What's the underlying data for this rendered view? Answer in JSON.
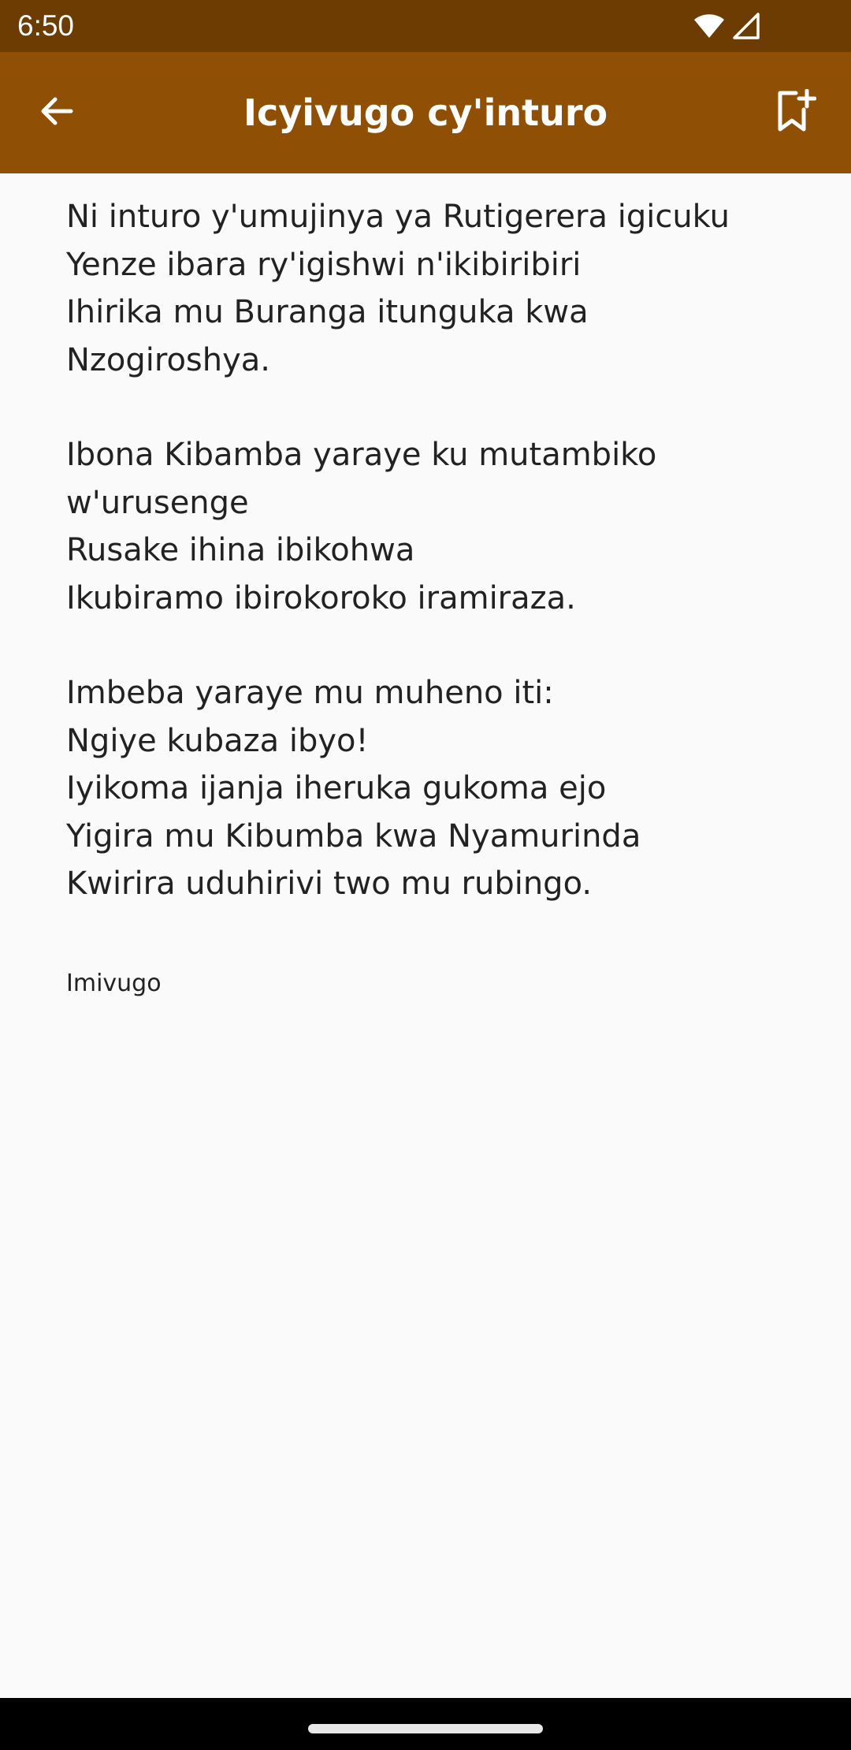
{
  "status_bar": {
    "time": "6:50",
    "icons": [
      "wifi-icon",
      "cellular-signal-icon"
    ]
  },
  "app_bar": {
    "title": "Icyivugo cy'inturo",
    "back_icon": "arrow-back-icon",
    "bookmark_icon": "bookmark-add-icon"
  },
  "poem": {
    "stanzas": [
      {
        "lines": [
          "Ni inturo y'umujinya ya Rutigerera igicuku",
          "Yenze ibara ry'igishwi n'ikibiribiri",
          "Ihirika mu Buranga itunguka kwa",
          "Nzogiroshya."
        ]
      },
      {
        "lines": [
          "Ibona Kibamba yaraye ku mutambiko",
          "w'urusenge",
          "Rusake ihina ibikohwa",
          "Ikubiramo ibirokoroko iramiraza."
        ]
      },
      {
        "lines": [
          "Imbeba yaraye mu muheno iti:",
          "Ngiye kubaza ibyo!",
          "Iyikoma ijanja iheruka gukoma ejo",
          "Yigira mu Kibumba kwa Nyamurinda",
          "Kwirira uduhirivi two mu rubingo."
        ]
      }
    ]
  },
  "category": {
    "label": "Imivugo"
  },
  "colors": {
    "status_bar": "#6d3c03",
    "app_bar": "#8f4f04",
    "background": "#fafafa",
    "text": "#222222"
  }
}
